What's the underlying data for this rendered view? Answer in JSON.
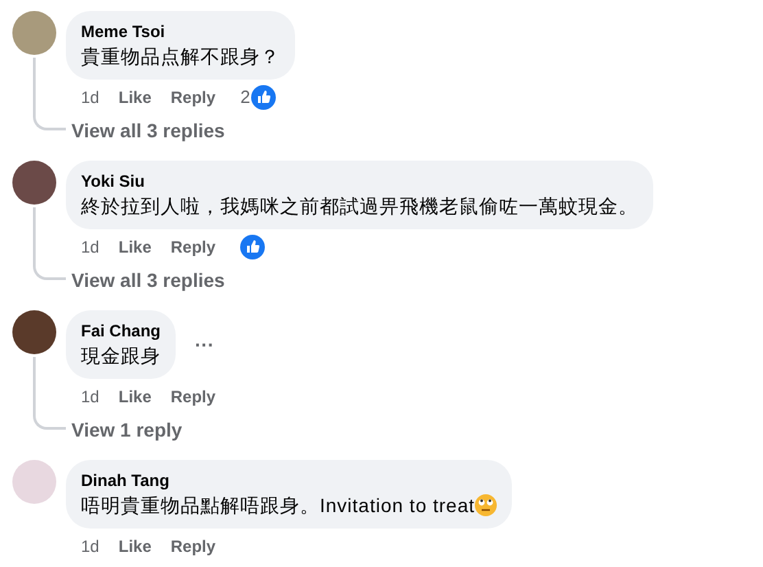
{
  "comments": [
    {
      "author": "Meme Tsoi",
      "text": "貴重物品点解不跟身？",
      "time": "1d",
      "like": "Like",
      "reply": "Reply",
      "reaction": true,
      "reaction_count": "2",
      "replies_link": "View all 3 replies"
    },
    {
      "author": "Yoki Siu",
      "text": "終於拉到人啦，我媽咪之前都試過畀飛機老鼠偷咗一萬蚊現金。",
      "time": "1d",
      "like": "Like",
      "reply": "Reply",
      "reaction": true,
      "replies_link": "View all 3 replies"
    },
    {
      "author": "Fai Chang",
      "text": "現金跟身",
      "menu": "···",
      "time": "1d",
      "like": "Like",
      "reply": "Reply",
      "reaction": false,
      "replies_link": "View 1 reply"
    },
    {
      "author": "Dinah Tang",
      "text": "唔明貴重物品點解唔跟身。Invitation to treat",
      "emoji": true,
      "time": "1d",
      "like": "Like",
      "reply": "Reply",
      "reaction": false
    }
  ]
}
